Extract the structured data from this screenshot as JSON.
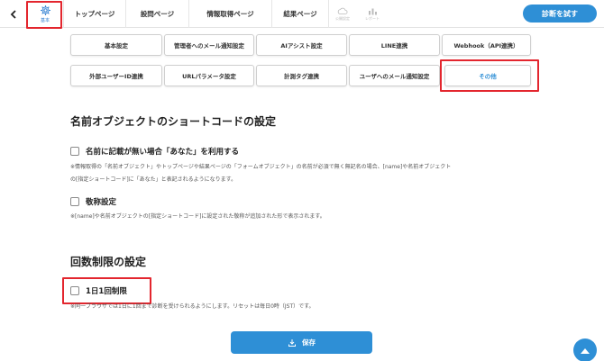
{
  "nav": {
    "back_icon": "chevron-left",
    "base_label": "基本",
    "tabs": [
      "トップページ",
      "設問ページ",
      "情報取得ページ",
      "結果ページ"
    ],
    "mini": [
      "公開設定",
      "レポート"
    ],
    "diagnose_button": "診断を試す"
  },
  "settings": {
    "row1": [
      "基本設定",
      "管理者へのメール通知設定",
      "AIアシスト設定",
      "LINE連携",
      "Webhook（API連携）"
    ],
    "row2": [
      "外部ユーザーID連携",
      "URLパラメータ設定",
      "計測タグ連携",
      "ユーザへのメール通知設定",
      "その他"
    ]
  },
  "shortcode": {
    "heading": "名前オブジェクトのショートコードの設定",
    "option1_label": "名前に記載が無い場合「あなた」を利用する",
    "note1_line1": "※情報取得の「名前オブジェクト」やトップページや結果ページの「フォームオブジェクト」の名前が必須で無く無記名の場合、[name]や名前オブジェクト",
    "note1_line2": "の[指定ショートコード]に「あなた」と表記されるようになります。",
    "option2_label": "敬称設定",
    "note2": "※[name]や名前オブジェクトの[指定ショートコード]に設定された敬称が追加された形で表示されます。"
  },
  "limit": {
    "heading": "回数制限の設定",
    "option_label": "1日1回制限",
    "note": "※同一ブラウザでは1日に1回まで診断を受けられるようにします。リセットは毎日0時（JST）です。"
  },
  "save_label": "保存",
  "colors": {
    "accent": "#2e8fd6",
    "highlight": "#e3262e"
  }
}
